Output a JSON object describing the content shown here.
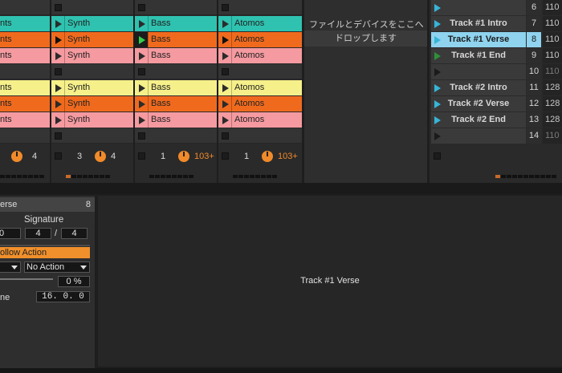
{
  "tracks": [
    {
      "clips": [
        "nts",
        "nts",
        "nts",
        "",
        "nts",
        "nts",
        "nts"
      ],
      "status_num": "",
      "status_val": "4"
    },
    {
      "clips": [
        "Synth",
        "Synth",
        "Synth",
        "",
        "Synth",
        "Synth",
        "Synth"
      ],
      "status_num": "3",
      "status_val": "4"
    },
    {
      "clips": [
        "Bass",
        "Bass",
        "Bass",
        "",
        "Bass",
        "Bass",
        "Bass"
      ],
      "status_num": "1",
      "status_val": "103+"
    },
    {
      "clips": [
        "Atomos",
        "Atomos",
        "Atomos",
        "",
        "Atomos",
        "Atomos",
        "Atomos"
      ],
      "status_num": "1",
      "status_val": "103+"
    }
  ],
  "drop_area": {
    "line1": "ファイルとデバイスをここへ",
    "line2": "ドロップします"
  },
  "scenes": [
    {
      "name": "",
      "number": "6",
      "tempo": "110"
    },
    {
      "name": "Track #1 Intro",
      "number": "7",
      "tempo": "110"
    },
    {
      "name": "Track #1 Verse",
      "number": "8",
      "tempo": "110"
    },
    {
      "name": "Track #1 End",
      "number": "9",
      "tempo": "110"
    },
    {
      "name": "",
      "number": "10",
      "tempo": "110"
    },
    {
      "name": "Track #2 Intro",
      "number": "11",
      "tempo": "128"
    },
    {
      "name": "Track #2 Verse",
      "number": "12",
      "tempo": "128"
    },
    {
      "name": "Track #2 End",
      "number": "13",
      "tempo": "128"
    },
    {
      "name": "",
      "number": "14",
      "tempo": "110"
    }
  ],
  "clip_panel": {
    "title": "erse",
    "index": "8",
    "signature_label": "Signature",
    "sig_left": "0",
    "sig_num": "4",
    "sig_slash": "/",
    "sig_den": "4",
    "follow_action_label": "ollow Action",
    "action_b": "No Action",
    "chance": "0 %",
    "time_label": "ne",
    "time_value": "16. 0. 0"
  },
  "main_view": {
    "label": "Track #1 Verse"
  },
  "colors": {
    "teal": "#2fc2b0",
    "orange": "#f06a1e",
    "pink": "#f59aa0",
    "yellow": "#f6f08a",
    "highlight": "#8fd3ee",
    "accent": "#f08a2a"
  }
}
